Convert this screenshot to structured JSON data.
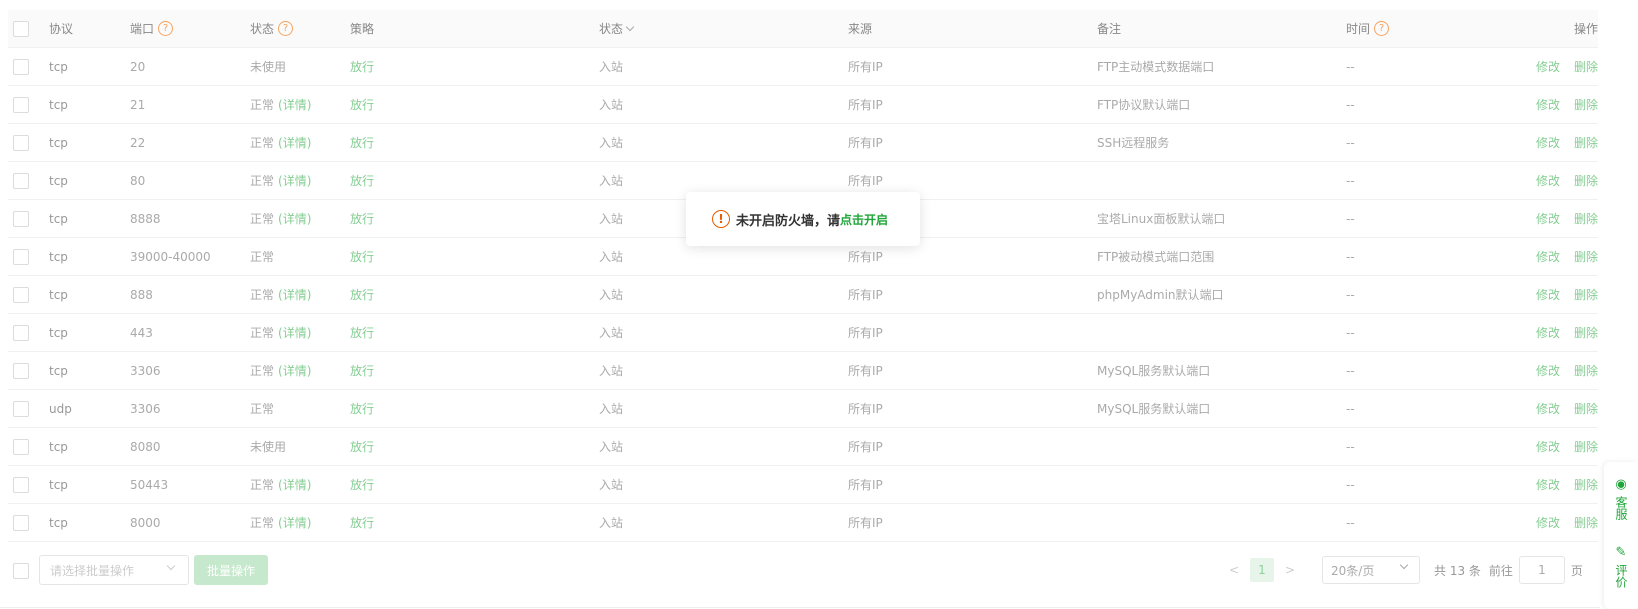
{
  "table": {
    "headers": {
      "protocol": "协议",
      "port": "端口",
      "state": "状态",
      "policy": "策略",
      "direction": "状态",
      "source": "来源",
      "note": "备注",
      "time": "时间",
      "ops": "操作"
    },
    "rows": [
      {
        "protocol": "tcp",
        "port": "20",
        "state": "未使用",
        "detail": "",
        "policy": "放行",
        "direction": "入站",
        "source": "所有IP",
        "note": "FTP主动模式数据端口",
        "time": "--",
        "edit": "修改",
        "del": "删除"
      },
      {
        "protocol": "tcp",
        "port": "21",
        "state": "正常",
        "detail": "(详情)",
        "policy": "放行",
        "direction": "入站",
        "source": "所有IP",
        "note": "FTP协议默认端口",
        "time": "--",
        "edit": "修改",
        "del": "删除"
      },
      {
        "protocol": "tcp",
        "port": "22",
        "state": "正常",
        "detail": "(详情)",
        "policy": "放行",
        "direction": "入站",
        "source": "所有IP",
        "note": "SSH远程服务",
        "time": "--",
        "edit": "修改",
        "del": "删除"
      },
      {
        "protocol": "tcp",
        "port": "80",
        "state": "正常",
        "detail": "(详情)",
        "policy": "放行",
        "direction": "入站",
        "source": "所有IP",
        "note": "",
        "time": "--",
        "edit": "修改",
        "del": "删除"
      },
      {
        "protocol": "tcp",
        "port": "8888",
        "state": "正常",
        "detail": "(详情)",
        "policy": "放行",
        "direction": "入站",
        "source": "",
        "note": "宝塔Linux面板默认端口",
        "time": "--",
        "edit": "修改",
        "del": "删除"
      },
      {
        "protocol": "tcp",
        "port": "39000-40000",
        "state": "正常",
        "detail": "",
        "policy": "放行",
        "direction": "入站",
        "source": "所有IP",
        "note": "FTP被动模式端口范围",
        "time": "--",
        "edit": "修改",
        "del": "删除"
      },
      {
        "protocol": "tcp",
        "port": "888",
        "state": "正常",
        "detail": "(详情)",
        "policy": "放行",
        "direction": "入站",
        "source": "所有IP",
        "note": "phpMyAdmin默认端口",
        "time": "--",
        "edit": "修改",
        "del": "删除"
      },
      {
        "protocol": "tcp",
        "port": "443",
        "state": "正常",
        "detail": "(详情)",
        "policy": "放行",
        "direction": "入站",
        "source": "所有IP",
        "note": "",
        "time": "--",
        "edit": "修改",
        "del": "删除"
      },
      {
        "protocol": "tcp",
        "port": "3306",
        "state": "正常",
        "detail": "(详情)",
        "policy": "放行",
        "direction": "入站",
        "source": "所有IP",
        "note": "MySQL服务默认端口",
        "time": "--",
        "edit": "修改",
        "del": "删除"
      },
      {
        "protocol": "udp",
        "port": "3306",
        "state": "正常",
        "detail": "",
        "policy": "放行",
        "direction": "入站",
        "source": "所有IP",
        "note": "MySQL服务默认端口",
        "time": "--",
        "edit": "修改",
        "del": "删除"
      },
      {
        "protocol": "tcp",
        "port": "8080",
        "state": "未使用",
        "detail": "",
        "policy": "放行",
        "direction": "入站",
        "source": "所有IP",
        "note": "",
        "time": "--",
        "edit": "修改",
        "del": "删除"
      },
      {
        "protocol": "tcp",
        "port": "50443",
        "state": "正常",
        "detail": "(详情)",
        "policy": "放行",
        "direction": "入站",
        "source": "所有IP",
        "note": "",
        "time": "--",
        "edit": "修改",
        "del": "删除"
      },
      {
        "protocol": "tcp",
        "port": "8000",
        "state": "正常",
        "detail": "(详情)",
        "policy": "放行",
        "direction": "入站",
        "source": "所有IP",
        "note": "",
        "time": "--",
        "edit": "修改",
        "del": "删除"
      }
    ]
  },
  "footer": {
    "batch_placeholder": "请选择批量操作",
    "batch_button": "批量操作",
    "page_current": "1",
    "page_size": "20条/页",
    "total": "共 13 条",
    "goto": "前往",
    "goto_value": "1",
    "page_suffix": "页"
  },
  "toast": {
    "message": "未开启防火墙，请",
    "link": "点击开启"
  },
  "side": {
    "service": "客服",
    "review": "评价"
  },
  "colors": {
    "accent": "#20a53a",
    "warning": "#e65c00"
  }
}
